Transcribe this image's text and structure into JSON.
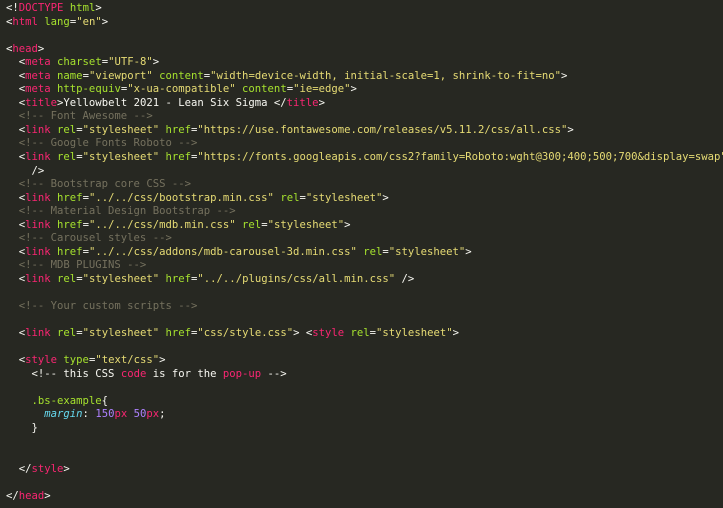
{
  "colors": {
    "background": "#272822",
    "punct": "#f8f8f2",
    "tag": "#f92672",
    "attr": "#a6e22e",
    "string": "#e6db74",
    "comment": "#75715e",
    "selector": "#a6e22e",
    "property": "#66d9ef",
    "number": "#ae81ff",
    "unit": "#f92672"
  },
  "lines": [
    [
      [
        "punct",
        "<!"
      ],
      [
        "doctype",
        "DOCTYPE"
      ],
      [
        "punct",
        " "
      ],
      [
        "attr",
        "html"
      ],
      [
        "punct",
        ">"
      ]
    ],
    [
      [
        "punct",
        "<"
      ],
      [
        "tag",
        "html"
      ],
      [
        "punct",
        " "
      ],
      [
        "attr",
        "lang"
      ],
      [
        "punct",
        "="
      ],
      [
        "str",
        "\"en\""
      ],
      [
        "punct",
        ">"
      ]
    ],
    [],
    [
      [
        "punct",
        "<"
      ],
      [
        "tag",
        "head"
      ],
      [
        "punct",
        ">"
      ]
    ],
    [
      [
        "punct",
        "  <"
      ],
      [
        "tag",
        "meta"
      ],
      [
        "punct",
        " "
      ],
      [
        "attr",
        "charset"
      ],
      [
        "punct",
        "="
      ],
      [
        "str",
        "\"UTF-8\""
      ],
      [
        "punct",
        ">"
      ]
    ],
    [
      [
        "punct",
        "  <"
      ],
      [
        "tag",
        "meta"
      ],
      [
        "punct",
        " "
      ],
      [
        "attr",
        "name"
      ],
      [
        "punct",
        "="
      ],
      [
        "str",
        "\"viewport\""
      ],
      [
        "punct",
        " "
      ],
      [
        "attr",
        "content"
      ],
      [
        "punct",
        "="
      ],
      [
        "str",
        "\"width=device-width, initial-scale=1, shrink-to-fit=no\""
      ],
      [
        "punct",
        ">"
      ]
    ],
    [
      [
        "punct",
        "  <"
      ],
      [
        "tag",
        "meta"
      ],
      [
        "punct",
        " "
      ],
      [
        "attr",
        "http-equiv"
      ],
      [
        "punct",
        "="
      ],
      [
        "str",
        "\"x-ua-compatible\""
      ],
      [
        "punct",
        " "
      ],
      [
        "attr",
        "content"
      ],
      [
        "punct",
        "="
      ],
      [
        "str",
        "\"ie=edge\""
      ],
      [
        "punct",
        ">"
      ]
    ],
    [
      [
        "punct",
        "  <"
      ],
      [
        "tag",
        "title"
      ],
      [
        "punct",
        ">"
      ],
      [
        "text",
        "Yellowbelt 2021 - Lean Six Sigma "
      ],
      [
        "punct",
        "</"
      ],
      [
        "tag",
        "title"
      ],
      [
        "punct",
        ">"
      ]
    ],
    [
      [
        "comment",
        "  <!-- Font Awesome -->"
      ]
    ],
    [
      [
        "punct",
        "  <"
      ],
      [
        "tag",
        "link"
      ],
      [
        "punct",
        " "
      ],
      [
        "attr",
        "rel"
      ],
      [
        "punct",
        "="
      ],
      [
        "str",
        "\"stylesheet\""
      ],
      [
        "punct",
        " "
      ],
      [
        "attr",
        "href"
      ],
      [
        "punct",
        "="
      ],
      [
        "str",
        "\"https://use.fontawesome.com/releases/v5.11.2/css/all.css\""
      ],
      [
        "punct",
        ">"
      ]
    ],
    [
      [
        "comment",
        "  <!-- Google Fonts Roboto -->"
      ]
    ],
    [
      [
        "punct",
        "  <"
      ],
      [
        "tag",
        "link"
      ],
      [
        "punct",
        " "
      ],
      [
        "attr",
        "rel"
      ],
      [
        "punct",
        "="
      ],
      [
        "str",
        "\"stylesheet\""
      ],
      [
        "punct",
        " "
      ],
      [
        "attr",
        "href"
      ],
      [
        "punct",
        "="
      ],
      [
        "str",
        "\"https://fonts.googleapis.com/css2?family=Roboto:wght@300;400;500;700&display=swap\""
      ]
    ],
    [
      [
        "punct",
        "    />"
      ]
    ],
    [
      [
        "comment",
        "  <!-- Bootstrap core CSS -->"
      ]
    ],
    [
      [
        "punct",
        "  <"
      ],
      [
        "tag",
        "link"
      ],
      [
        "punct",
        " "
      ],
      [
        "attr",
        "href"
      ],
      [
        "punct",
        "="
      ],
      [
        "str",
        "\"../../css/bootstrap.min.css\""
      ],
      [
        "punct",
        " "
      ],
      [
        "attr",
        "rel"
      ],
      [
        "punct",
        "="
      ],
      [
        "str",
        "\"stylesheet\""
      ],
      [
        "punct",
        ">"
      ]
    ],
    [
      [
        "comment",
        "  <!-- Material Design Bootstrap -->"
      ]
    ],
    [
      [
        "punct",
        "  <"
      ],
      [
        "tag",
        "link"
      ],
      [
        "punct",
        " "
      ],
      [
        "attr",
        "href"
      ],
      [
        "punct",
        "="
      ],
      [
        "str",
        "\"../../css/mdb.min.css\""
      ],
      [
        "punct",
        " "
      ],
      [
        "attr",
        "rel"
      ],
      [
        "punct",
        "="
      ],
      [
        "str",
        "\"stylesheet\""
      ],
      [
        "punct",
        ">"
      ]
    ],
    [
      [
        "comment",
        "  <!-- Carousel styles -->"
      ]
    ],
    [
      [
        "punct",
        "  <"
      ],
      [
        "tag",
        "link"
      ],
      [
        "punct",
        " "
      ],
      [
        "attr",
        "href"
      ],
      [
        "punct",
        "="
      ],
      [
        "str",
        "\"../../css/addons/mdb-carousel-3d.min.css\""
      ],
      [
        "punct",
        " "
      ],
      [
        "attr",
        "rel"
      ],
      [
        "punct",
        "="
      ],
      [
        "str",
        "\"stylesheet\""
      ],
      [
        "punct",
        ">"
      ]
    ],
    [
      [
        "comment",
        "  <!-- MDB PLUGINS -->"
      ]
    ],
    [
      [
        "punct",
        "  <"
      ],
      [
        "tag",
        "link"
      ],
      [
        "punct",
        " "
      ],
      [
        "attr",
        "rel"
      ],
      [
        "punct",
        "="
      ],
      [
        "str",
        "\"stylesheet\""
      ],
      [
        "punct",
        " "
      ],
      [
        "attr",
        "href"
      ],
      [
        "punct",
        "="
      ],
      [
        "str",
        "\"../../plugins/css/all.min.css\""
      ],
      [
        "punct",
        " />"
      ]
    ],
    [],
    [
      [
        "comment",
        "  <!-- Your custom scripts -->"
      ]
    ],
    [],
    [
      [
        "punct",
        "  <"
      ],
      [
        "tag",
        "link"
      ],
      [
        "punct",
        " "
      ],
      [
        "attr",
        "rel"
      ],
      [
        "punct",
        "="
      ],
      [
        "str",
        "\"stylesheet\""
      ],
      [
        "punct",
        " "
      ],
      [
        "attr",
        "href"
      ],
      [
        "punct",
        "="
      ],
      [
        "str",
        "\"css/style.css\""
      ],
      [
        "punct",
        "> <"
      ],
      [
        "tag",
        "style"
      ],
      [
        "punct",
        " "
      ],
      [
        "attr",
        "rel"
      ],
      [
        "punct",
        "="
      ],
      [
        "str",
        "\"stylesheet\""
      ],
      [
        "punct",
        ">"
      ]
    ],
    [],
    [
      [
        "punct",
        "  <"
      ],
      [
        "tag",
        "style"
      ],
      [
        "punct",
        " "
      ],
      [
        "attr",
        "type"
      ],
      [
        "punct",
        "="
      ],
      [
        "str",
        "\"text/css\""
      ],
      [
        "punct",
        ">"
      ]
    ],
    [
      [
        "punct",
        "    <!-- "
      ],
      [
        "text",
        "this CSS "
      ],
      [
        "tag",
        "code"
      ],
      [
        "text",
        " is for the "
      ],
      [
        "tag",
        "pop-up"
      ],
      [
        "punct",
        " -->"
      ]
    ],
    [],
    [
      [
        "sel",
        "    .bs-example"
      ],
      [
        "punct",
        "{"
      ]
    ],
    [
      [
        "prop",
        "      margin"
      ],
      [
        "punct",
        ": "
      ],
      [
        "num",
        "150"
      ],
      [
        "unit",
        "px"
      ],
      [
        "punct",
        " "
      ],
      [
        "num",
        "50"
      ],
      [
        "unit",
        "px"
      ],
      [
        "punct",
        ";"
      ]
    ],
    [
      [
        "punct",
        "    }"
      ]
    ],
    [],
    [],
    [
      [
        "punct",
        "  </"
      ],
      [
        "tag",
        "style"
      ],
      [
        "punct",
        ">"
      ]
    ],
    [],
    [
      [
        "punct",
        "</"
      ],
      [
        "tag",
        "head"
      ],
      [
        "punct",
        ">"
      ]
    ]
  ]
}
